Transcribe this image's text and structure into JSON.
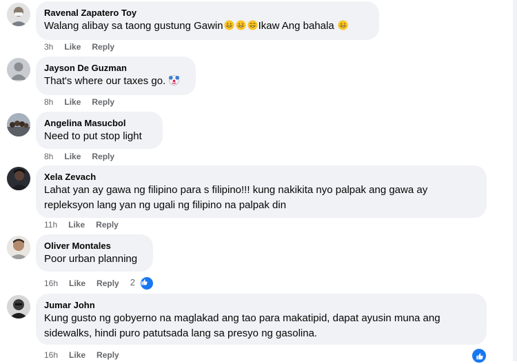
{
  "comments": [
    {
      "author": "Ravenal Zapatero Toy",
      "text_before": "Walang alibay sa taong gustung Gawin",
      "text_middle": "Ikaw Ang bahala",
      "time": "3h",
      "like": "Like",
      "reply": "Reply",
      "avatar": "profile-photo-man-masked"
    },
    {
      "author": "Jayson De Guzman",
      "text": "That's where our taxes go.",
      "time": "8h",
      "like": "Like",
      "reply": "Reply",
      "avatar": "default-silhouette"
    },
    {
      "author": "Angelina Masucbol",
      "text": "Need to put stop light",
      "time": "8h",
      "like": "Like",
      "reply": "Reply",
      "avatar": "group-photo"
    },
    {
      "author": "Xela Zevach",
      "text_line1": "Lahat yan ay gawa ng filipino para s filipino!!! kung nakikita nyo palpak ang gawa ay",
      "text_line2": "repleksyon lang yan ng ugali ng filipino na palpak din",
      "time": "11h",
      "like": "Like",
      "reply": "Reply",
      "avatar": "profile-photo-dark"
    },
    {
      "author": "Oliver Montales",
      "text": "Poor urban planning",
      "time": "16h",
      "like": "Like",
      "reply": "Reply",
      "reaction_count": "2",
      "avatar": "profile-photo-man"
    },
    {
      "author": "Jumar John",
      "text_line1": "Kung gusto ng gobyerno na maglakad ang tao para makatipid, dapat ayusin muna ang",
      "text_line2": "sidewalks, hindi puro patutsada lang sa presyo ng gasolina.",
      "time": "16h",
      "like": "Like",
      "reply": "Reply",
      "avatar": "profile-photo-dark-bw"
    }
  ],
  "colors": {
    "bubble": "#f0f2f5",
    "meta": "#65676b",
    "like_blue": "#1877f2"
  }
}
